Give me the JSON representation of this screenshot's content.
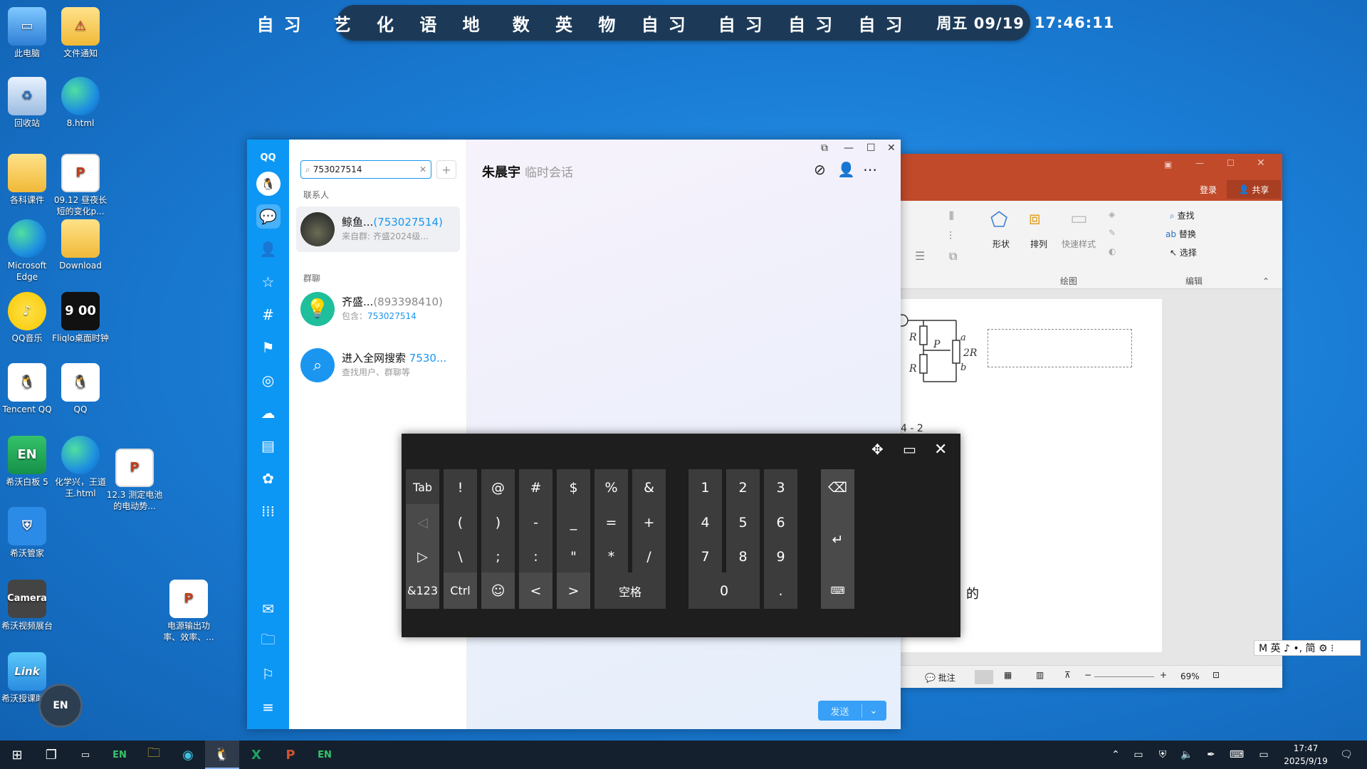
{
  "schedule": {
    "segments": [
      "自习",
      "艺 化 语 地",
      "数 英 物 自习",
      "自习 自习 自习"
    ],
    "date": "周五 09/19",
    "time": "17:46:11"
  },
  "desktop_icons": [
    {
      "label": "此电脑",
      "icon": "computer-icon"
    },
    {
      "label": "文件通知",
      "icon": "folder-warning-icon"
    },
    {
      "label": "回收站",
      "icon": "recycle-bin-icon"
    },
    {
      "label": "8.html",
      "icon": "edge-icon"
    },
    {
      "label": "各科课件",
      "icon": "folder-icon"
    },
    {
      "label": "09.12 昼夜长短的变化p...",
      "icon": "ppt-file-icon"
    },
    {
      "label": "Microsoft Edge",
      "icon": "edge-icon"
    },
    {
      "label": "Download",
      "icon": "folder-icon"
    },
    {
      "label": "QQ音乐",
      "icon": "qq-music-icon"
    },
    {
      "label": "Fliqlo桌面时钟",
      "icon": "clock-icon",
      "glyph": "9 00"
    },
    {
      "label": "Tencent QQ",
      "icon": "qq-icon"
    },
    {
      "label": "QQ",
      "icon": "qq-icon"
    },
    {
      "label": "希沃白板 5",
      "icon": "en-icon",
      "glyph": "EN"
    },
    {
      "label": "化学兴，王道王.html",
      "icon": "edge-icon"
    },
    {
      "label": "12.3 测定电池的电动势...",
      "icon": "ppt-file-icon"
    },
    {
      "label": "希沃管家",
      "icon": "shield-icon"
    },
    {
      "label": "希沃视频展台",
      "icon": "camera-icon",
      "glyph": "Camera"
    },
    {
      "label": "电源输出功率、效率、...",
      "icon": "ppt-file-icon"
    },
    {
      "label": "希沃授课助手",
      "icon": "link-icon",
      "glyph": "Link"
    }
  ],
  "qq": {
    "logo": "QQ",
    "search_value": "753027514",
    "contacts_title": "联系人",
    "groups_title": "群聊",
    "contact": {
      "name": "鲸鱼...",
      "num": "(753027514)",
      "sub": "来自群: 齐盛2024级..."
    },
    "group": {
      "name": "齐盛...",
      "num": "(893398410)",
      "sub_prefix": "包含：",
      "sub_value": "753027514"
    },
    "websearch": {
      "name": "进入全网搜索",
      "num": "7530...",
      "sub": "查找用户、群聊等"
    },
    "chat_name": "朱晨宇",
    "chat_sub": "临时会话",
    "send_label": "发送"
  },
  "ppt": {
    "login": "登录",
    "share": "共享",
    "ribbon": {
      "shape": "形状",
      "arrange": "排列",
      "quick_style": "快速样式",
      "find": "查找",
      "replace": "替换",
      "select": "选择",
      "draw_group": "绘图",
      "edit_group": "编辑"
    },
    "slide_text": "的",
    "fig_caption": "4 - 2",
    "status_comment": "批注",
    "zoom": "69%"
  },
  "keyboard": {
    "row1": [
      "Tab",
      "!",
      "@",
      "#",
      "$",
      "%",
      "&"
    ],
    "row2": [
      "(",
      ")",
      "-",
      "_",
      "=",
      "+"
    ],
    "row3": [
      "\\",
      ";",
      ":",
      "\"",
      "*",
      "/"
    ],
    "row4_left": [
      "&123",
      "Ctrl"
    ],
    "space": "空格",
    "numpad": [
      "1",
      "2",
      "3",
      "4",
      "5",
      "6",
      "7",
      "8",
      "9",
      "0",
      "."
    ]
  },
  "ime": {
    "text": "M 英 ♪ •, 简 ⚙ ⁝"
  },
  "taskbar": {
    "clock_time": "17:47",
    "clock_date": "2025/9/19"
  },
  "floating_button": "EN"
}
